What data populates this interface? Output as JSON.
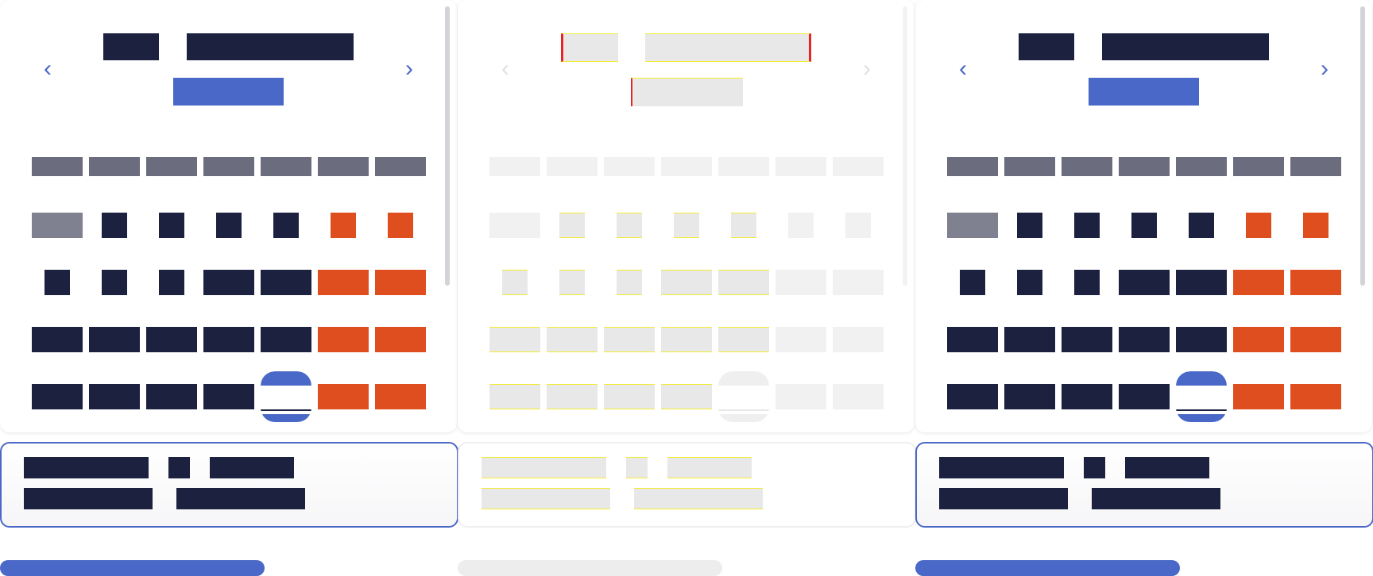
{
  "calendar": {
    "prev_label": "‹",
    "next_label": "›",
    "month_title": "",
    "year_label": "",
    "weekdays": [
      "",
      "",
      "",
      "",
      "",
      "",
      ""
    ],
    "days": [
      "",
      "",
      "",
      "",
      "",
      "",
      "",
      "",
      "",
      "",
      "",
      "",
      "",
      "",
      "",
      "",
      "",
      "",
      "",
      "",
      "",
      "",
      "",
      "",
      "",
      "",
      "",
      "",
      ""
    ],
    "selected_day": ""
  },
  "summary": {
    "line1_a": "",
    "line1_b": "",
    "line1_c": "",
    "line2_a": "",
    "line2_b": ""
  },
  "footer": {
    "button_label": ""
  },
  "colors": {
    "accent": "#4a68c7",
    "text_dark": "#1d2140",
    "weekend": "#df4e1f",
    "weekday_header": "#6b6c7e",
    "muted_day": "#7f8090"
  },
  "icons": {
    "prev": "chevron-left-icon",
    "next": "chevron-right-icon"
  }
}
